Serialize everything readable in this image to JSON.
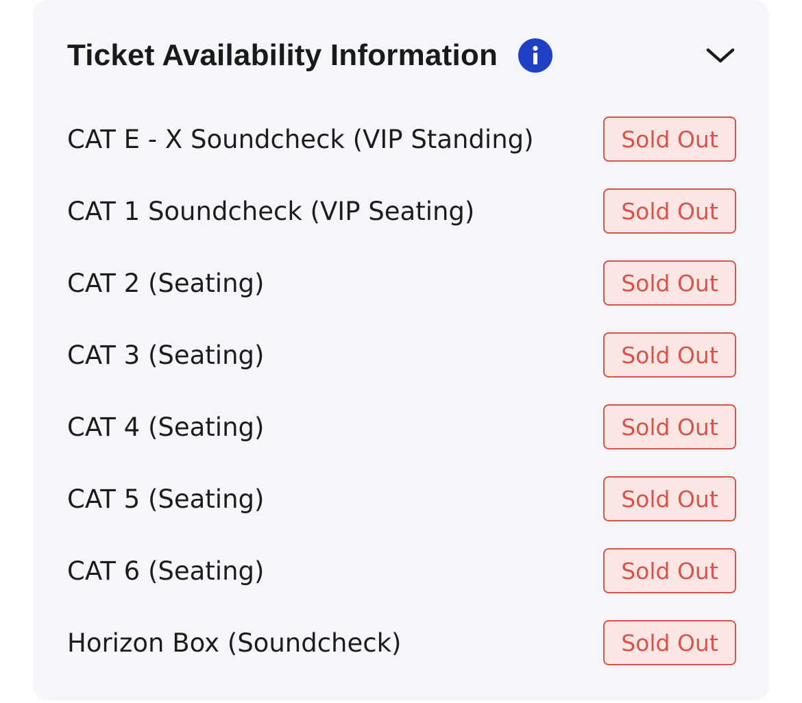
{
  "panel": {
    "title": "Ticket Availability Information",
    "info_icon": "info-icon",
    "collapse_icon": "chevron-down-icon",
    "accent_color": "#1f3fc4"
  },
  "tickets": [
    {
      "name": "CAT E - X Soundcheck (VIP Standing)",
      "status": "Sold Out"
    },
    {
      "name": "CAT 1 Soundcheck (VIP Seating)",
      "status": "Sold Out"
    },
    {
      "name": "CAT 2 (Seating)",
      "status": "Sold Out"
    },
    {
      "name": "CAT 3 (Seating)",
      "status": "Sold Out"
    },
    {
      "name": "CAT 4 (Seating)",
      "status": "Sold Out"
    },
    {
      "name": "CAT 5 (Seating)",
      "status": "Sold Out"
    },
    {
      "name": "CAT 6 (Seating)",
      "status": "Sold Out"
    },
    {
      "name": "Horizon Box (Soundcheck)",
      "status": "Sold Out"
    }
  ],
  "status_colors": {
    "sold_out_text": "#d9534a",
    "sold_out_bg": "#fde6e4"
  }
}
